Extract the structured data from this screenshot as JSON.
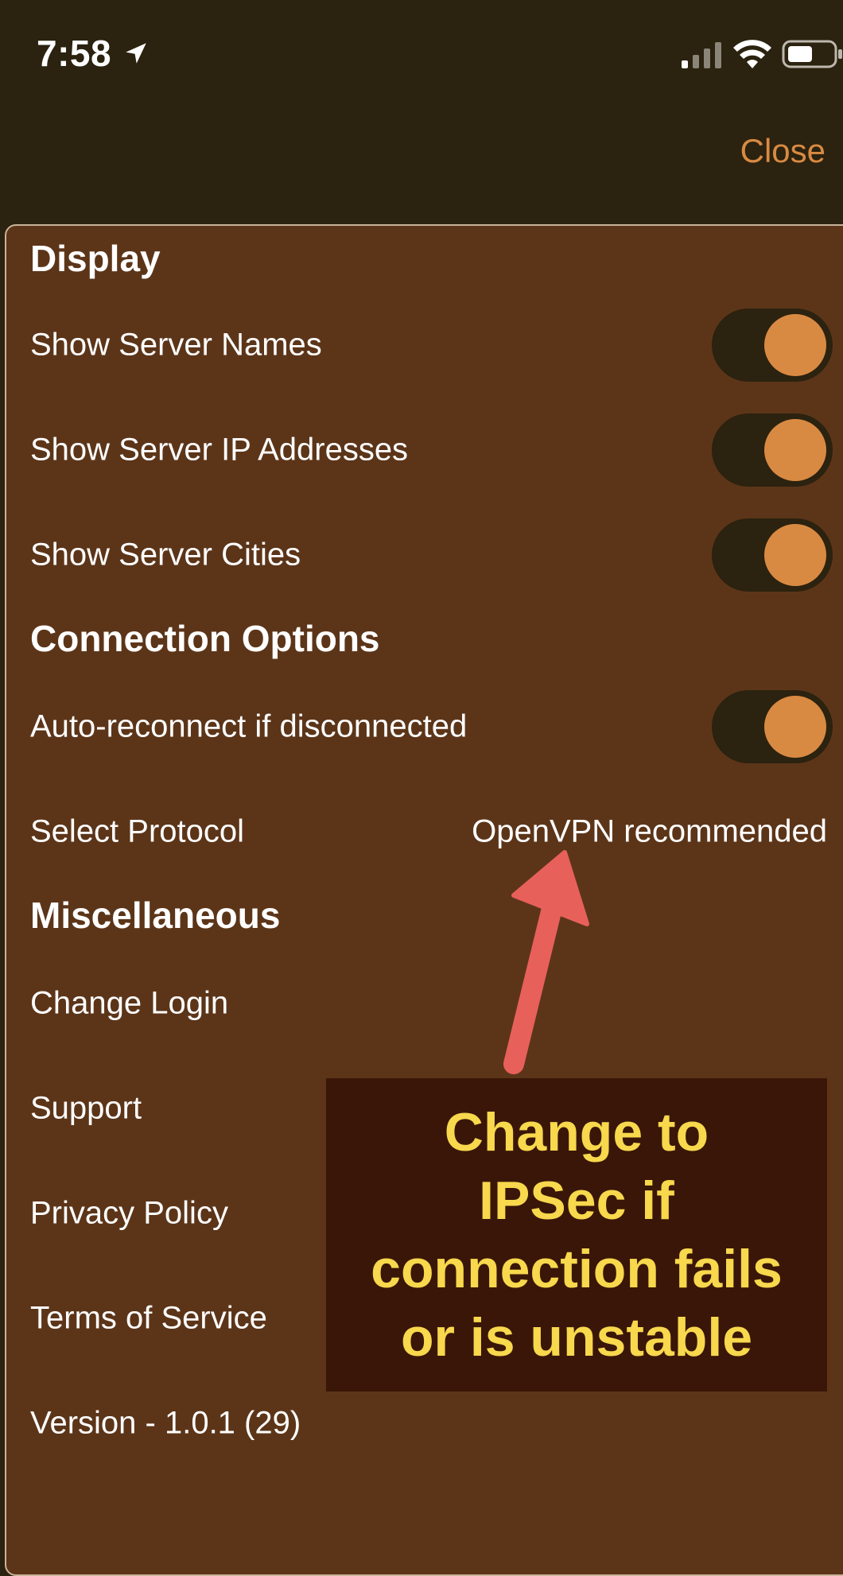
{
  "status_bar": {
    "time": "7:58"
  },
  "nav": {
    "close_label": "Close"
  },
  "sections": {
    "display": {
      "title": "Display",
      "rows": [
        {
          "label": "Show Server Names",
          "toggle_on": true
        },
        {
          "label": "Show Server IP Addresses",
          "toggle_on": true
        },
        {
          "label": "Show Server Cities",
          "toggle_on": true
        }
      ]
    },
    "connection": {
      "title": "Connection Options",
      "auto_reconnect_label": "Auto-reconnect if disconnected",
      "auto_reconnect_on": true,
      "protocol_label": "Select Protocol",
      "protocol_value": "OpenVPN recommended"
    },
    "misc": {
      "title": "Miscellaneous",
      "items": [
        {
          "label": "Change Login"
        },
        {
          "label": "Support"
        },
        {
          "label": "Privacy Policy"
        },
        {
          "label": "Terms of Service"
        },
        {
          "label": "Version - 1.0.1 (29)"
        }
      ]
    }
  },
  "annotation": {
    "lines": [
      "Change to",
      "IPSec if",
      "connection fails",
      "or is unstable"
    ]
  },
  "colors": {
    "background": "#2b220f",
    "sheet": "#5c3519",
    "accent": "#d98a42",
    "callout_bg": "#3a1608",
    "callout_text": "#f8d84c",
    "arrow": "#e8605a"
  }
}
